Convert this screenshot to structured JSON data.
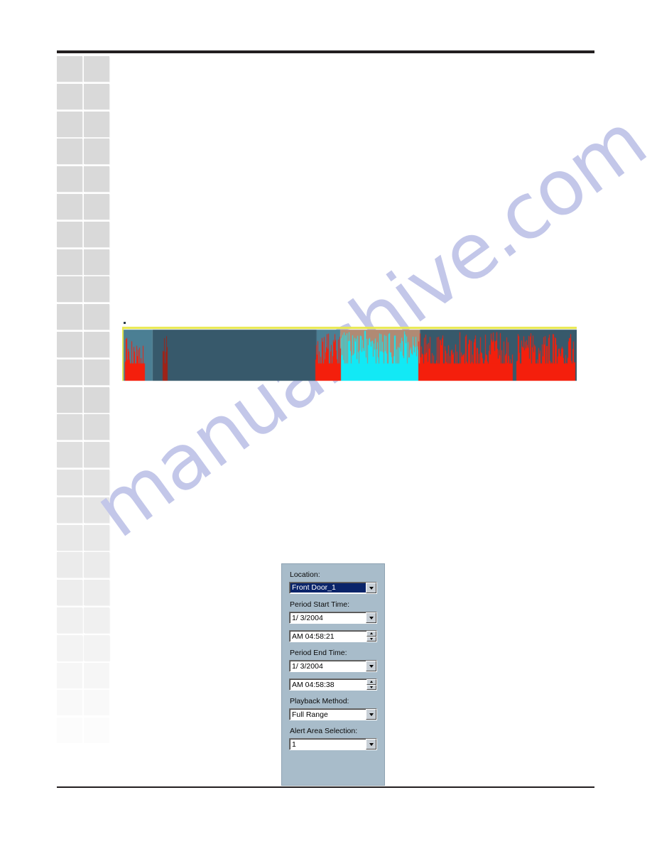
{
  "page": {
    "background_color": "#ffffff",
    "rule_color": "#231f20"
  },
  "watermark": {
    "text": "manualshive.com",
    "color": "#c3c7e9"
  },
  "sidebar": {
    "name": "thumbnail-strip",
    "square_color": "#d9d9d9",
    "columns": 2,
    "rows": 26
  },
  "timeline": {
    "name": "event-activity-timeline",
    "border_color": "#e8e84a",
    "colors": {
      "yellow_border": "#e8e84a",
      "band_light_teal": "#4b7f94",
      "band_dark_teal": "#37596b",
      "band_tan": "#b08a74",
      "spike_red": "#f41f0c",
      "spike_cyan": "#12e9f5",
      "spike_dark_red": "#9e2318"
    },
    "bands": [
      {
        "start_pct": 0.0,
        "end_pct": 6.7,
        "color": "#4b7f94"
      },
      {
        "start_pct": 6.7,
        "end_pct": 42.8,
        "color": "#37596b"
      },
      {
        "start_pct": 42.8,
        "end_pct": 48.0,
        "color": "#4b7f94"
      },
      {
        "start_pct": 48.0,
        "end_pct": 65.5,
        "color": "#b08a74"
      },
      {
        "start_pct": 65.5,
        "end_pct": 100.0,
        "color": "#37596b"
      }
    ],
    "segments": [
      {
        "name": "red-burst-left",
        "start_pct": 0.6,
        "end_pct": 5.0,
        "color": "#f41f0c",
        "density": 0.55,
        "min_h": 0.3,
        "max_h": 0.92
      },
      {
        "name": "single-spike",
        "start_pct": 9.0,
        "end_pct": 9.9,
        "color": "#9e2318",
        "density": 0.9,
        "min_h": 0.55,
        "max_h": 0.95
      },
      {
        "name": "red-burst-mid",
        "start_pct": 42.5,
        "end_pct": 48.2,
        "color": "#f41f0c",
        "density": 0.8,
        "min_h": 0.35,
        "max_h": 0.95
      },
      {
        "name": "cyan-burst",
        "start_pct": 48.2,
        "end_pct": 65.3,
        "color": "#12e9f5",
        "density": 0.85,
        "min_h": 0.4,
        "max_h": 0.98
      },
      {
        "name": "red-burst-right-1",
        "start_pct": 65.3,
        "end_pct": 85.8,
        "color": "#f41f0c",
        "density": 0.82,
        "min_h": 0.32,
        "max_h": 0.96
      },
      {
        "name": "red-burst-right-2",
        "start_pct": 86.8,
        "end_pct": 99.6,
        "color": "#f41f0c",
        "density": 0.82,
        "min_h": 0.32,
        "max_h": 0.96
      }
    ]
  },
  "dialog": {
    "name": "playback-settings-panel",
    "background_color": "#a8bcca",
    "fields": [
      {
        "name": "location",
        "label": "Location:",
        "value": "Front Door_1",
        "control": "combobox",
        "selected": true
      },
      {
        "name": "period-start-date",
        "label": "Period Start Time:",
        "value": "1/  3/2004",
        "control": "combobox",
        "selected": false
      },
      {
        "name": "period-start-time",
        "label": "",
        "value": "AM 04:58:21",
        "control": "spinner",
        "selected": false
      },
      {
        "name": "period-end-date",
        "label": "Period End Time:",
        "value": "1/  3/2004",
        "control": "combobox",
        "selected": false
      },
      {
        "name": "period-end-time",
        "label": "",
        "value": "AM 04:58:38",
        "control": "spinner",
        "selected": false
      },
      {
        "name": "playback-method",
        "label": "Playback Method:",
        "value": "Full Range",
        "control": "combobox",
        "selected": false
      },
      {
        "name": "alert-area-selection",
        "label": "Alert Area Selection:",
        "value": "1",
        "control": "combobox",
        "selected": false
      }
    ]
  }
}
